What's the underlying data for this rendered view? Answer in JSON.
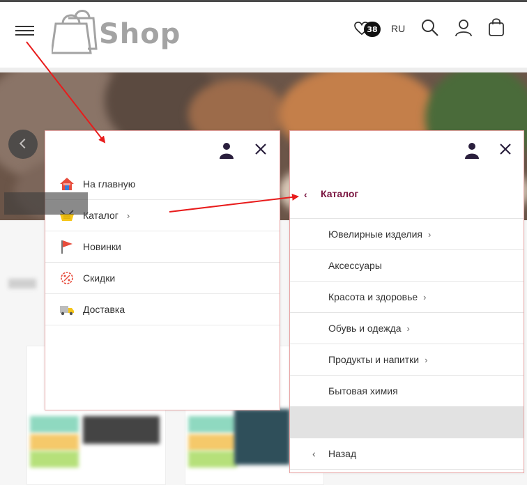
{
  "header": {
    "logo_text": "Shop",
    "favorites_count": "38",
    "language": "RU",
    "icons": [
      "menu-icon",
      "heart-icon",
      "search-icon",
      "user-icon",
      "bag-icon"
    ]
  },
  "main_menu": {
    "items": [
      {
        "label": "На главную",
        "icon": "home-icon",
        "has_submenu": false
      },
      {
        "label": "Каталог",
        "icon": "basket-icon",
        "has_submenu": true,
        "arrow": "›"
      },
      {
        "label": "Новинки",
        "icon": "flag-icon",
        "has_submenu": false
      },
      {
        "label": "Скидки",
        "icon": "discount-icon",
        "has_submenu": false
      },
      {
        "label": "Доставка",
        "icon": "truck-icon",
        "has_submenu": false
      }
    ]
  },
  "catalog_menu": {
    "back_glyph": "‹",
    "title": "Каталог",
    "items": [
      {
        "label": "Ювелирные изделия",
        "arrow": "›"
      },
      {
        "label": "Аксессуары",
        "arrow": ""
      },
      {
        "label": "Красота и здоровье",
        "arrow": "›"
      },
      {
        "label": "Обувь и одежда",
        "arrow": "›"
      },
      {
        "label": "Продукты и напитки",
        "arrow": "›"
      },
      {
        "label": "Бытовая химия",
        "arrow": ""
      }
    ],
    "back_label": "Назад",
    "back_arrow": "‹"
  },
  "colors": {
    "accent": "#7a1540",
    "annotation_arrow": "#e81c1c",
    "panel_border": "#e8a6a6",
    "logo": "#a3a3a3"
  }
}
